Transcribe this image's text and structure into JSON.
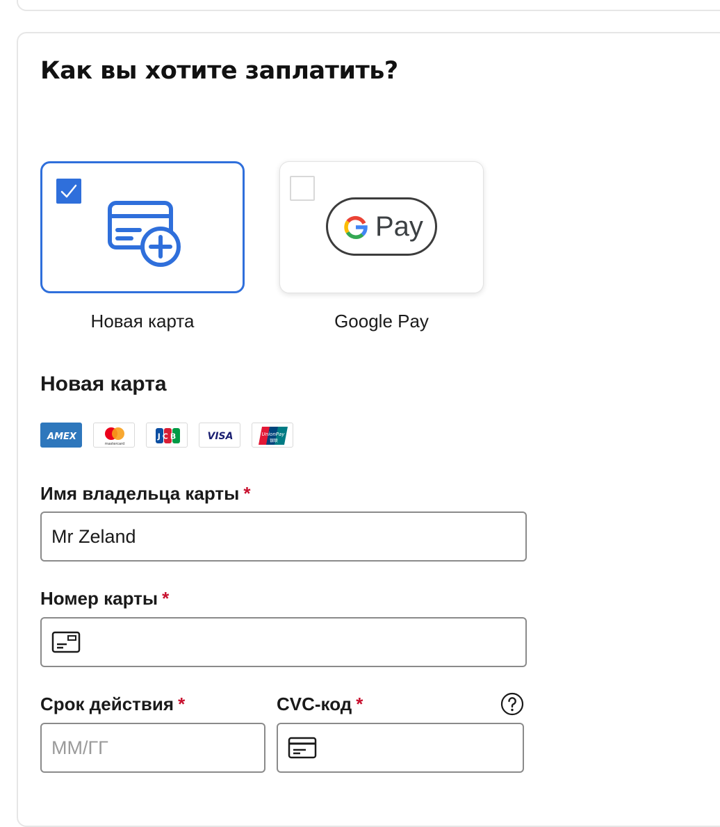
{
  "header": {
    "title": "Как вы хотите заплатить?"
  },
  "payment_options": [
    {
      "label": "Новая карта",
      "selected": true,
      "icon": "new-card-icon"
    },
    {
      "label": "Google Pay",
      "selected": false,
      "icon": "google-pay-logo",
      "logo_text": "Pay"
    }
  ],
  "new_card": {
    "title": "Новая карта",
    "brands": [
      {
        "name": "AMEX",
        "icon": "amex-icon"
      },
      {
        "name": "mastercard",
        "icon": "mastercard-icon"
      },
      {
        "name": "JCB",
        "icon": "jcb-icon"
      },
      {
        "name": "VISA",
        "icon": "visa-icon"
      },
      {
        "name": "UnionPay",
        "icon": "unionpay-icon",
        "subtext": "银联"
      }
    ],
    "required_mark": "*",
    "fields": {
      "cardholder": {
        "label": "Имя владельца карты",
        "value": "Mr Zeland"
      },
      "card_number": {
        "label": "Номер карты",
        "value": ""
      },
      "expiry": {
        "label": "Срок действия",
        "placeholder": "ММ/ГГ"
      },
      "cvc": {
        "label": "CVC-код",
        "help_icon": "question-circle-icon"
      }
    }
  },
  "colors": {
    "accent": "#2f6fdb",
    "required": "#c8102e",
    "border": "#8a8a8a"
  }
}
